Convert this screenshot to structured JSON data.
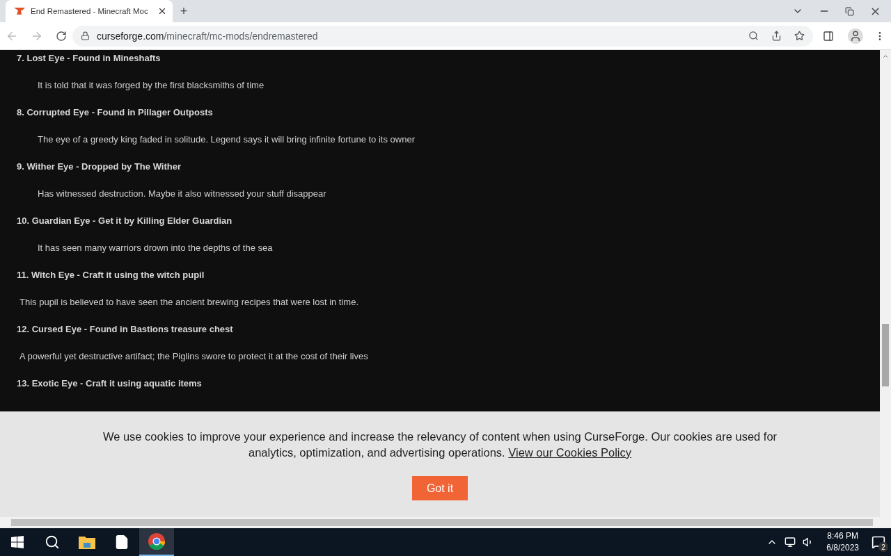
{
  "browser": {
    "tab": {
      "title": "End Remastered - Minecraft Moc",
      "selected": true
    },
    "new_tab": "+",
    "url": {
      "domain": "curseforge.com",
      "path": "/minecraft/mc-mods/endremastered"
    }
  },
  "entries": [
    {
      "heading": "7. Lost Eye - Found in Mineshafts",
      "description": "It is told that it was forged by the first blacksmiths of time",
      "kind": "indented"
    },
    {
      "heading": "8. Corrupted Eye - Found in Pillager Outposts",
      "description": "The eye of a greedy king faded in solitude. Legend says it will bring infinite fortune to its owner",
      "kind": "indented"
    },
    {
      "heading": "9. Wither Eye - Dropped by The Wither",
      "description": "Has witnessed destruction. Maybe it also witnessed your stuff disappear",
      "kind": "indented"
    },
    {
      "heading": "10. Guardian Eye - Get it by Killing Elder Guardian",
      "description": "It has seen many warriors drown into the depths of the sea",
      "kind": "indented"
    },
    {
      "heading": "11. Witch Eye - Craft it using the witch pupil",
      "description": "This pupil is believed to have seen the ancient brewing recipes that were lost in time.",
      "kind": "plain"
    },
    {
      "heading": "12. Cursed Eye - Found in Bastions treasure chest",
      "description": "A powerful yet destructive artifact; the Piglins swore to protect it at the cost of their lives",
      "kind": "plain"
    },
    {
      "heading": "13. Exotic Eye - Craft it using aquatic items"
    }
  ],
  "cookie_banner": {
    "text": "We use cookies to improve your experience and increase the relevancy of content when using CurseForge. Our cookies are used for analytics, optimization, and advertising operations.",
    "link": "View our Cookies Policy",
    "button": "Got it"
  },
  "taskbar": {
    "time": "8:46 PM",
    "date": "6/8/2023",
    "notifications": "2"
  }
}
